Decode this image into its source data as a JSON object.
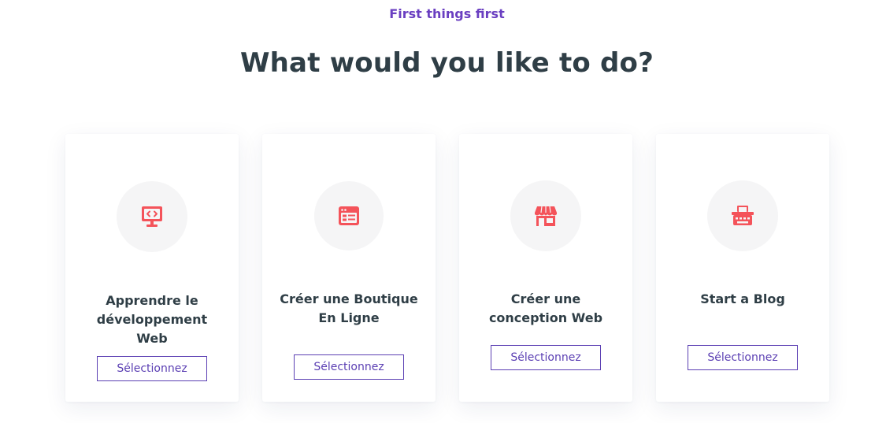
{
  "header": {
    "eyebrow": "First things first",
    "title": "What would you like to do?"
  },
  "accent_color": "#6a3fc1",
  "icon_color": "#f4535a",
  "cards": [
    {
      "title": "Apprendre le développement Web",
      "icon": "code-monitor-icon",
      "button_label": "Sélectionnez"
    },
    {
      "title": "Créer une Boutique En Ligne",
      "icon": "browser-window-icon",
      "button_label": "Sélectionnez"
    },
    {
      "title": "Créer une conception Web",
      "icon": "storefront-icon",
      "button_label": "Sélectionnez"
    },
    {
      "title": "Start a Blog",
      "icon": "typewriter-icon",
      "button_label": "Sélectionnez"
    }
  ]
}
